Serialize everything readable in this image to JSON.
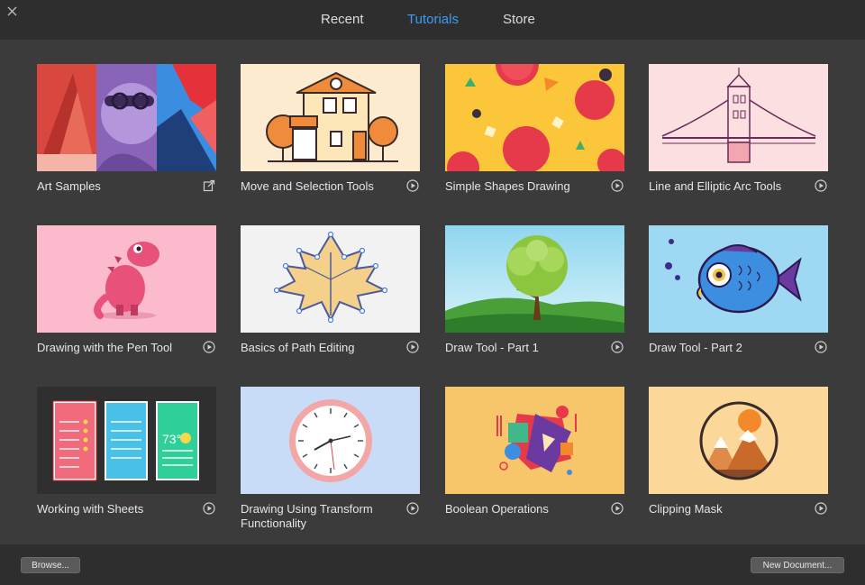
{
  "window": {
    "tabs": [
      {
        "label": "Recent",
        "active": false
      },
      {
        "label": "Tutorials",
        "active": true
      },
      {
        "label": "Store",
        "active": false
      }
    ],
    "accent_color": "#3e9bf2"
  },
  "cards": [
    {
      "title": "Art Samples",
      "action_icon": "external-link-icon"
    },
    {
      "title": "Move and Selection Tools",
      "action_icon": "play-icon"
    },
    {
      "title": "Simple Shapes Drawing",
      "action_icon": "play-icon"
    },
    {
      "title": "Line and Elliptic Arc Tools",
      "action_icon": "play-icon"
    },
    {
      "title": "Drawing with the Pen Tool",
      "action_icon": "play-icon"
    },
    {
      "title": "Basics of Path Editing",
      "action_icon": "play-icon"
    },
    {
      "title": "Draw Tool - Part 1",
      "action_icon": "play-icon"
    },
    {
      "title": "Draw Tool - Part 2",
      "action_icon": "play-icon"
    },
    {
      "title": "Working with Sheets",
      "action_icon": "play-icon"
    },
    {
      "title": "Drawing Using Transform Functionality",
      "action_icon": "play-icon"
    },
    {
      "title": "Boolean Operations",
      "action_icon": "play-icon"
    },
    {
      "title": "Clipping Mask",
      "action_icon": "play-icon"
    }
  ],
  "footer": {
    "browse_label": "Browse...",
    "new_document_label": "New Document..."
  }
}
